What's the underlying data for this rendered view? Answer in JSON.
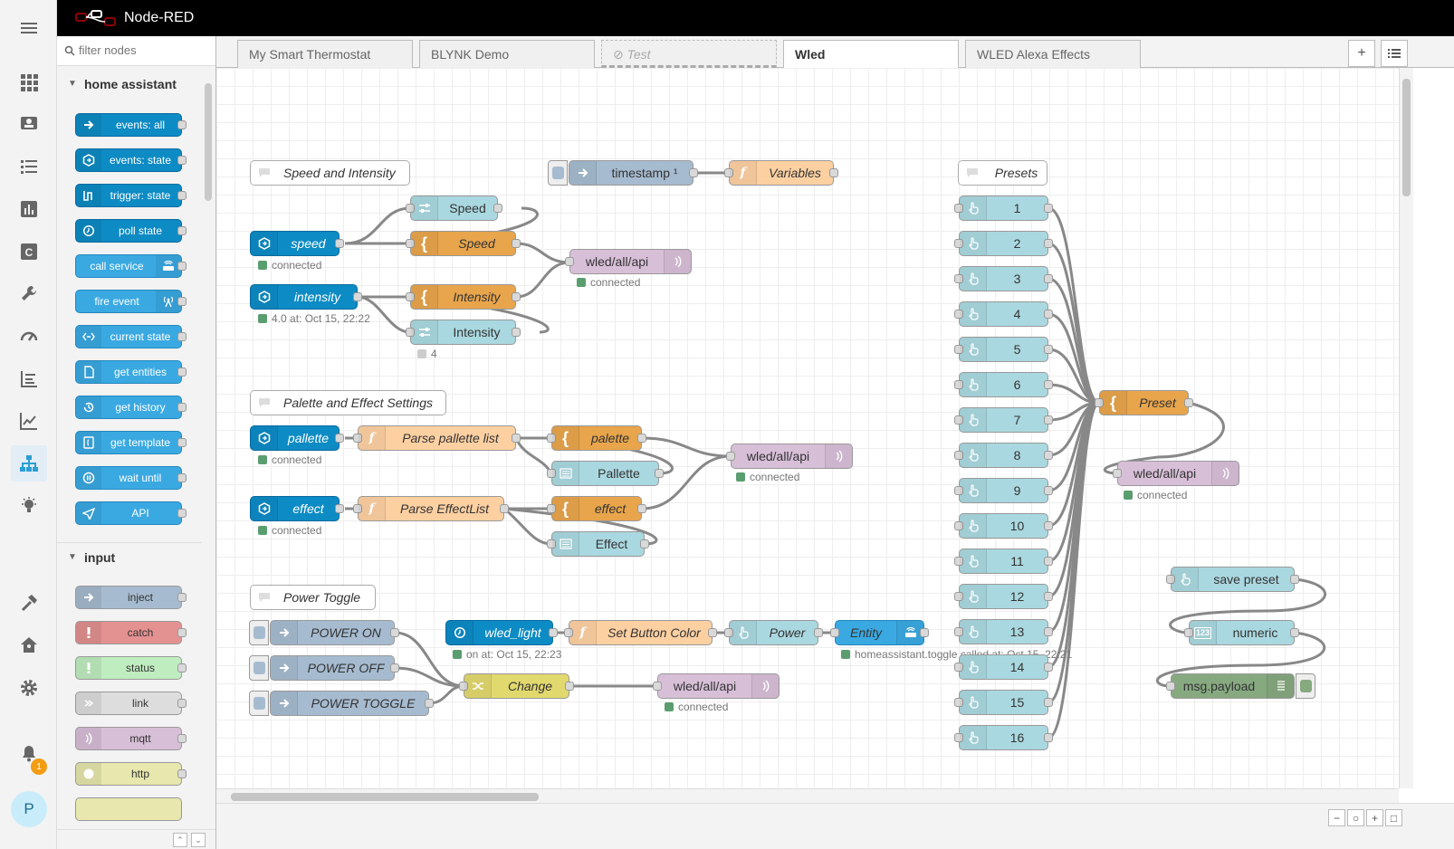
{
  "app": {
    "title": "Node-RED"
  },
  "palette": {
    "search_placeholder": "filter nodes",
    "categories": [
      {
        "label": "home assistant",
        "items": [
          "events: all",
          "events: state",
          "trigger: state",
          "poll state",
          "call service",
          "fire event",
          "current state",
          "get entities",
          "get history",
          "get template",
          "wait until",
          "API"
        ]
      },
      {
        "label": "input",
        "items": [
          "inject",
          "catch",
          "status",
          "link",
          "mqtt",
          "http"
        ]
      }
    ]
  },
  "tabs": [
    {
      "label": "My Smart Thermostat",
      "state": "normal"
    },
    {
      "label": "BLYNK Demo",
      "state": "normal"
    },
    {
      "label": "Test",
      "state": "disabled"
    },
    {
      "label": "Wled",
      "state": "active"
    },
    {
      "label": "WLED Alexa Effects",
      "state": "normal"
    }
  ],
  "flow": {
    "comments": {
      "speed_intensity": "Speed and Intensity",
      "presets": "Presets",
      "palette_effect": "Palette and Effect Settings",
      "power_toggle": "Power Toggle"
    },
    "nodes": {
      "timestamp": "timestamp ¹",
      "variables": "Variables",
      "speed_in": "speed",
      "speed_slider": "Speed",
      "speed_tpl": "Speed",
      "wled_api_1": "wled/all/api",
      "intensity_in": "intensity",
      "intensity_tpl": "Intensity",
      "intensity_slider": "Intensity",
      "palette_in": "pallette",
      "parse_palette": "Parse pallette list",
      "palette_tpl": "palette",
      "pallette_dd": "Pallette",
      "wled_api_2": "wled/all/api",
      "effect_in": "effect",
      "parse_effect": "Parse EffectList",
      "effect_tpl": "effect",
      "effect_dd": "Effect",
      "power_on": "POWER ON",
      "power_off": "POWER OFF",
      "power_toggle": "POWER TOGGLE",
      "wled_light": "wled_light",
      "set_button_color": "Set Button Color",
      "power_btn": "Power",
      "entity": "Entity",
      "change": "Change",
      "wled_api_3": "wled/all/api",
      "preset_tpl": "Preset",
      "wled_api_4": "wled/all/api",
      "save_preset": "save preset",
      "numeric": "numeric",
      "msg_payload": "msg.payload",
      "presets": [
        "1",
        "2",
        "3",
        "4",
        "5",
        "6",
        "7",
        "8",
        "9",
        "10",
        "11",
        "12",
        "13",
        "14",
        "15",
        "16"
      ]
    },
    "status": {
      "speed": "connected",
      "wled1": "connected",
      "intensity": "4.0 at: Oct 15, 22:22",
      "intensity_slider": "4",
      "palette": "connected",
      "wled2": "connected",
      "effect": "connected",
      "wled_light": "on at: Oct 15, 22:23",
      "entity": "homeassistant.toggle called at: Oct 15, 22:21",
      "wled3": "connected",
      "wled4": "connected"
    }
  },
  "notifications": {
    "count": "1"
  },
  "user": {
    "initial": "P"
  },
  "colors": {
    "ha_dark": "#0d8bc4",
    "ha_light": "#3aa9e2",
    "template": "#e8a54c",
    "function": "#fdd0a2",
    "inject": "#a6bbcf",
    "mqtt": "#d8bfd8",
    "dashboard": "#aad8e0",
    "change": "#e2d96e",
    "debug": "#87a980"
  }
}
